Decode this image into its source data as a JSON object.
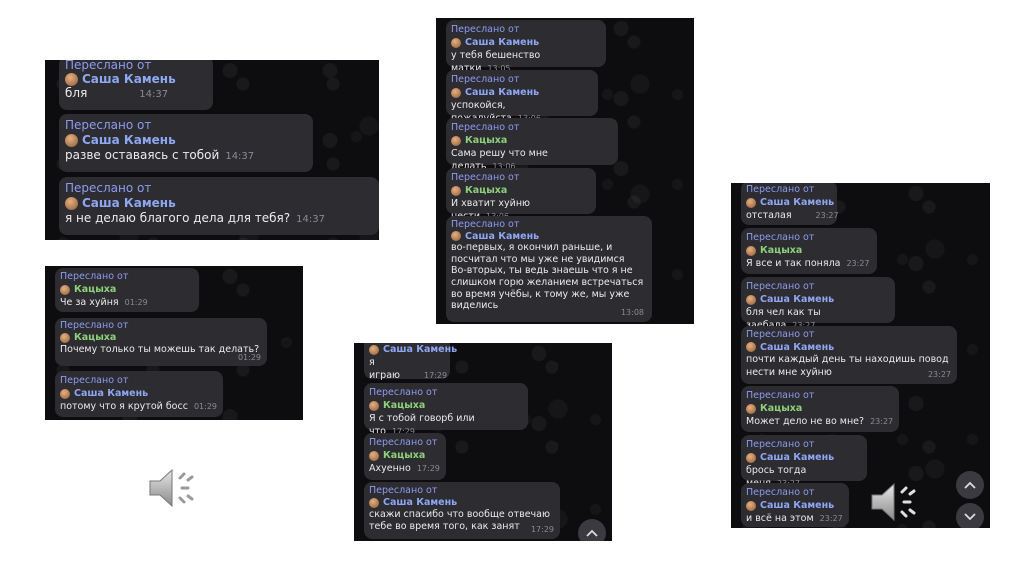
{
  "forwarded_label": "Переслано от",
  "screens": [
    {
      "messages": [
        {
          "source": "Саша Камень",
          "text": "бля",
          "time": "14:37"
        },
        {
          "source": "Саша Камень",
          "text": "разве оставаясь с тобой",
          "time": "14:37"
        },
        {
          "source": "Саша Камень",
          "text": "я не делаю благого дела для тебя?",
          "time": "14:37"
        }
      ]
    },
    {
      "messages": [
        {
          "source": "Кацыха",
          "text": "Че за хуйня",
          "time": "01:29"
        },
        {
          "source": "Кацыха",
          "text": "Почему только ты можешь так делать?",
          "time": "01:29"
        },
        {
          "source": "Саша Камень",
          "text": "потому что я крутой босс",
          "time": "01:29"
        }
      ]
    },
    {
      "messages": [
        {
          "source": "Саша Камень",
          "text": "у тебя бешенство матки",
          "time": "13:05"
        },
        {
          "source": "Саша Камень",
          "text": "успокойся, пожалуйста",
          "time": "13:06"
        },
        {
          "source": "Кацыха",
          "text": "Сама решу что мне делать",
          "time": "13:06"
        },
        {
          "source": "Кацыха",
          "text": "И хватит хуйню нести",
          "time": "13:06"
        },
        {
          "source": "Саша Камень",
          "lines": [
            "во-первых, я окончил раньше, и",
            "посчитал что мы уже не увидимся",
            "Во-вторых, ты ведь знаешь что я не",
            "слишком горю желанием встречаться",
            "во время учёбы, к тому же, мы уже",
            "виделись"
          ],
          "time": "13:08"
        }
      ]
    },
    {
      "messages": [
        {
          "source": "Саша Камень",
          "text": "я играю",
          "time": "17:29"
        },
        {
          "source": "Кацыха",
          "text": "Я с тобой говорб или что",
          "time": "17:29"
        },
        {
          "source": "Кацыха",
          "text": "Ахуенно",
          "time": "17:29"
        },
        {
          "source": "Саша Камень",
          "lines": [
            "скажи спасибо что вообще отвечаю",
            "тебе во время того, как занят"
          ],
          "time": "17:29"
        }
      ],
      "nav": [
        "chevron-up"
      ]
    },
    {
      "messages": [
        {
          "source": "Саша Камень",
          "text": "отсталая",
          "time": "23:27"
        },
        {
          "source": "Кацыха",
          "text": "Я все и так поняла",
          "time": "23:27"
        },
        {
          "source": "Саша Камень",
          "text": "бля чел как ты заебала",
          "time": "23:27"
        },
        {
          "source": "Саша Камень",
          "lines": [
            "почти каждый день ты находишь повод",
            "нести мне хуйню"
          ],
          "time": "23:27"
        },
        {
          "source": "Кацыха",
          "text": "Может дело не во мне?",
          "time": "23:27"
        },
        {
          "source": "Саша Камень",
          "text": "брось тогда меня",
          "time": "23:27"
        },
        {
          "source": "Саша Камень",
          "text": "и всё на этом",
          "time": "23:27"
        }
      ],
      "nav": [
        "chevron-up",
        "chevron-down"
      ]
    }
  ],
  "icons": {
    "chevron_up": "chevron-up-icon",
    "chevron_down": "chevron-down-icon",
    "speaker": "speaker-icon"
  },
  "colors": {
    "background": "#0d0d10",
    "bubble": "#2c2c31",
    "forwarded": "#8f9bf0",
    "source_sasha": "#8fa6f2",
    "source_kats": "#8fd07a"
  }
}
